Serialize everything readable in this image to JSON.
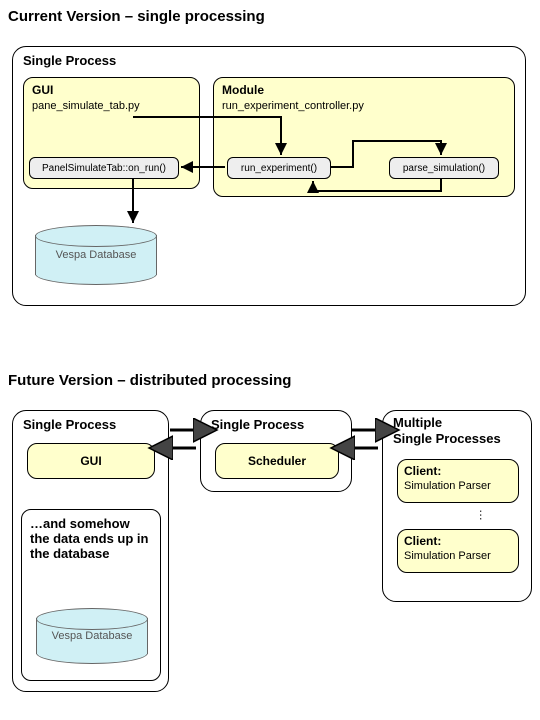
{
  "headings": {
    "current": "Current Version – single processing",
    "future": "Future Version – distributed processing"
  },
  "current": {
    "panel_title": "Single Process",
    "gui_title": "GUI",
    "gui_file": "pane_simulate_tab.py",
    "gui_method": "PanelSimulateTab::on_run()",
    "module_title": "Module",
    "module_file": "run_experiment_controller.py",
    "module_method1": "run_experiment()",
    "module_method2": "parse_simulation()",
    "db_label": "Vespa Database"
  },
  "future": {
    "left": {
      "panel_title": "Single Process",
      "gui_title": "GUI",
      "note": "…and somehow the data ends up in the database",
      "db_label": "Vespa Database"
    },
    "middle": {
      "panel_title": "Single Process",
      "scheduler": "Scheduler"
    },
    "right": {
      "panel_title_l1": "Multiple",
      "panel_title_l2": "Single Processes",
      "client_label": "Client:",
      "client_role": "Simulation Parser"
    }
  }
}
